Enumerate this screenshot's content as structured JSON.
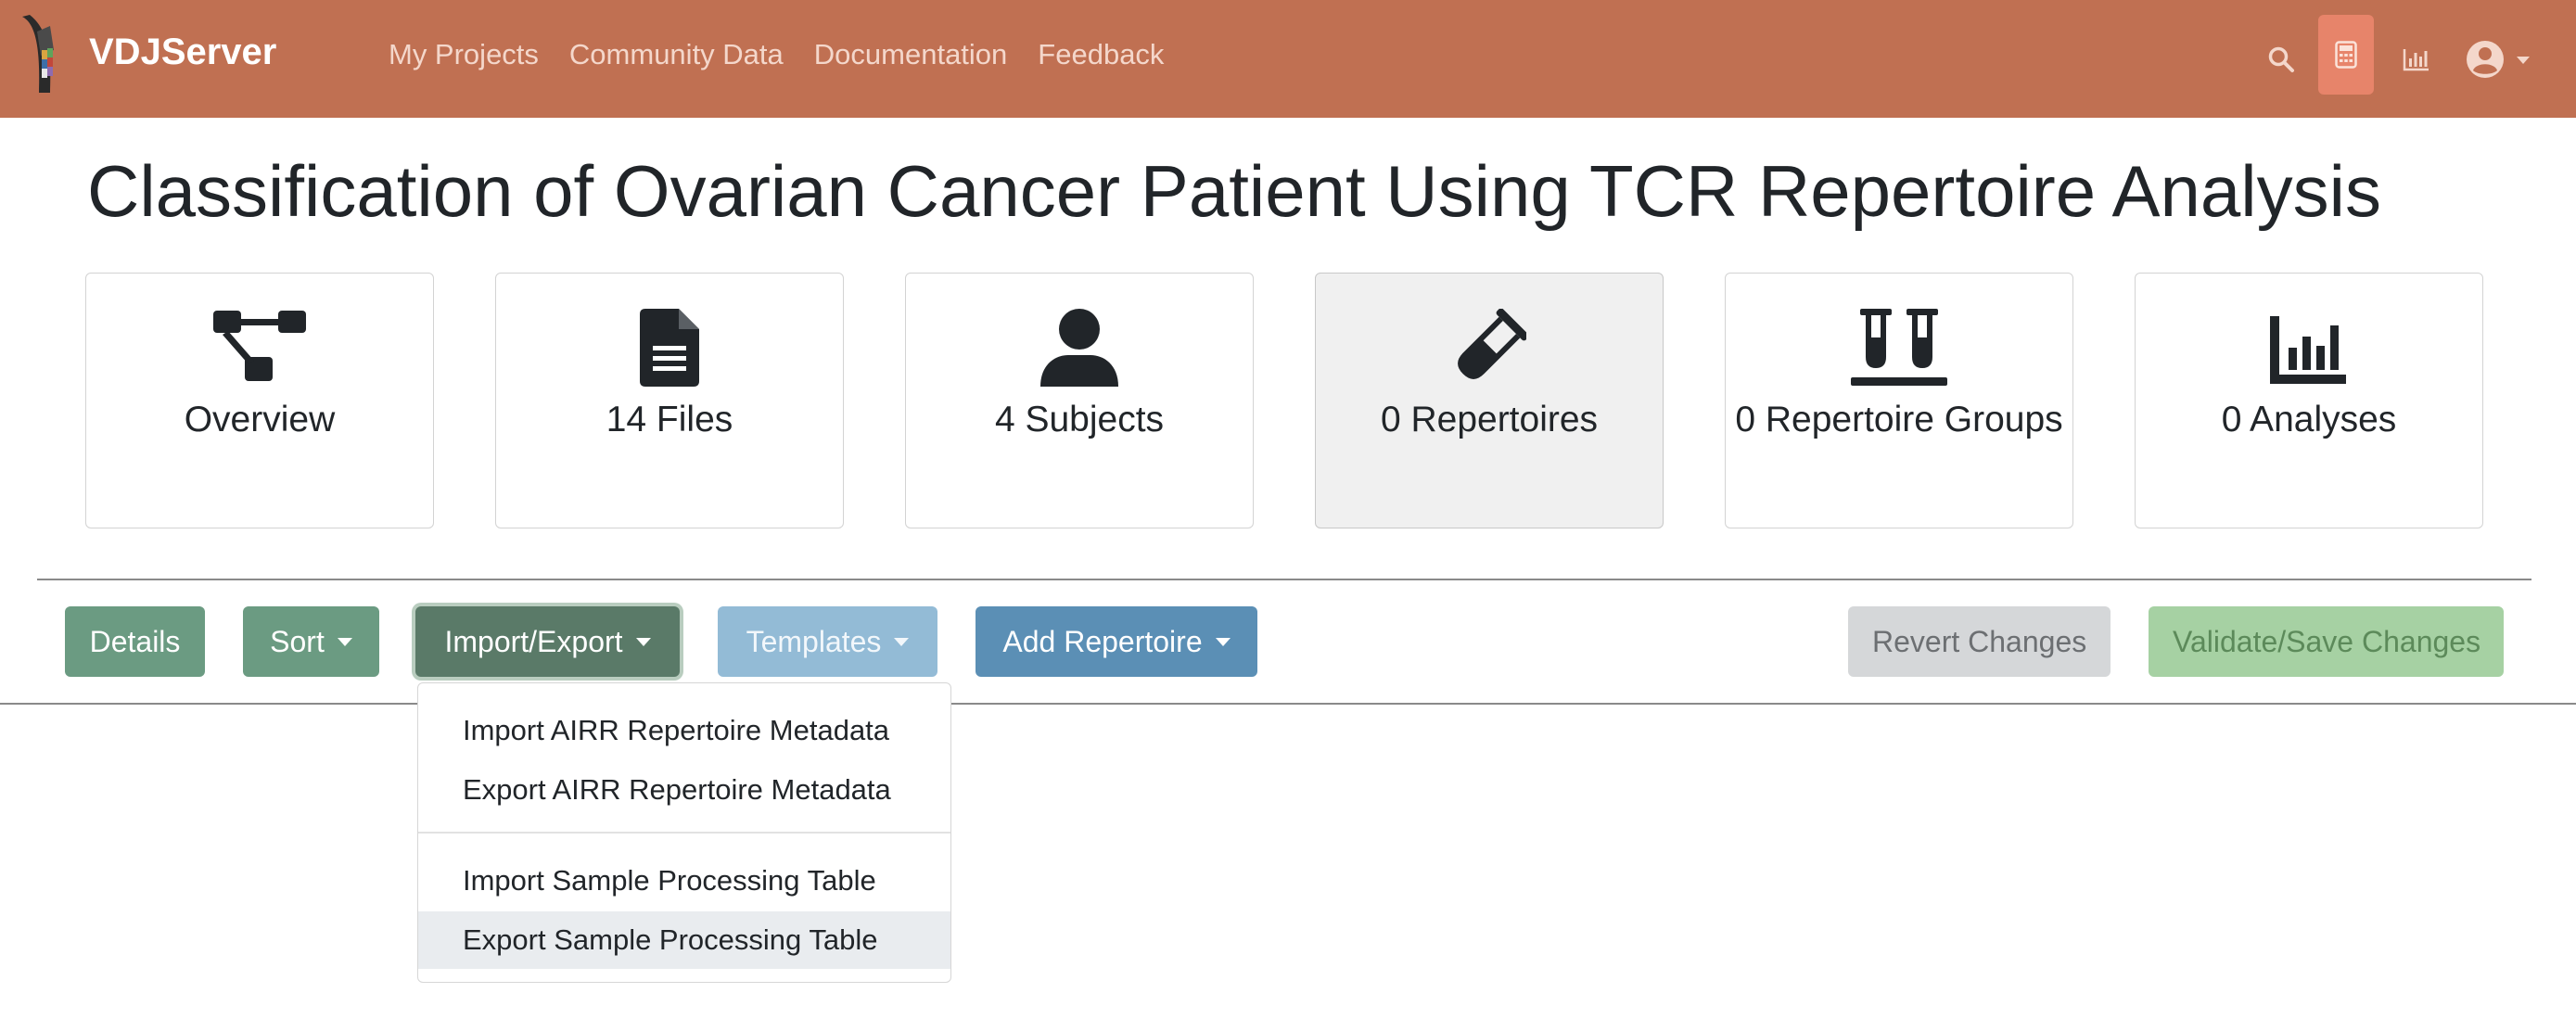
{
  "navbar": {
    "brand": "VDJServer",
    "links": [
      "My Projects",
      "Community Data",
      "Documentation",
      "Feedback"
    ],
    "icons": [
      "search-icon",
      "calculator-icon",
      "chart-bar-icon",
      "user-circle-icon"
    ],
    "background": "#c07052",
    "active_icon_bg": "#e7846a"
  },
  "page": {
    "title": "Classification of Ovarian Cancer Patient Using TCR Repertoire Analysis"
  },
  "tiles": [
    {
      "label": "Overview",
      "icon": "sitemap-icon",
      "active": false
    },
    {
      "label": "14 Files",
      "icon": "file-icon",
      "active": false
    },
    {
      "label": "4 Subjects",
      "icon": "user-icon",
      "active": false
    },
    {
      "label": "0 Repertoires",
      "icon": "vial-icon",
      "active": true
    },
    {
      "label": "0 Repertoire Groups",
      "icon": "vials-icon",
      "active": false
    },
    {
      "label": "0 Analyses",
      "icon": "chart-column-icon",
      "active": false
    }
  ],
  "toolbar": {
    "details": "Details",
    "sort": "Sort",
    "import_export": "Import/Export",
    "templates": "Templates",
    "add_repertoire": "Add Repertoire",
    "revert": "Revert Changes",
    "validate_save": "Validate/Save Changes"
  },
  "dropdown": {
    "items": [
      "Import AIRR Repertoire Metadata",
      "Export AIRR Repertoire Metadata",
      "Import Sample Processing Table",
      "Export Sample Processing Table"
    ],
    "hovered_index": 3
  }
}
